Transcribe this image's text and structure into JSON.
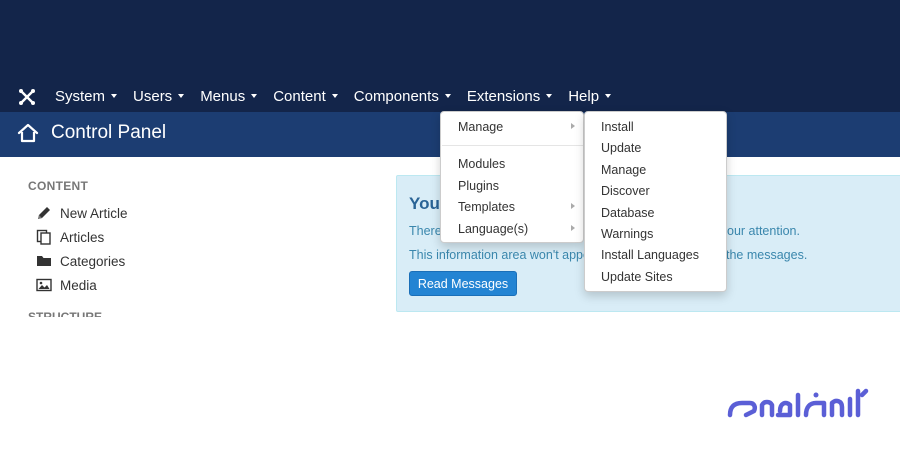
{
  "nav": {
    "items": [
      {
        "label": "System"
      },
      {
        "label": "Users"
      },
      {
        "label": "Menus"
      },
      {
        "label": "Content"
      },
      {
        "label": "Components"
      },
      {
        "label": "Extensions"
      },
      {
        "label": "Help"
      }
    ],
    "active": "Extensions"
  },
  "header": {
    "title": "Control Panel",
    "icon": "home-icon"
  },
  "sidebar": {
    "heading": "CONTENT",
    "items": [
      {
        "label": "New Article",
        "icon": "pencil-icon"
      },
      {
        "label": "Articles",
        "icon": "copy-icon"
      },
      {
        "label": "Categories",
        "icon": "folder-icon"
      },
      {
        "label": "Media",
        "icon": "image-icon"
      }
    ],
    "next_heading": "STRUCTURE"
  },
  "alert": {
    "heading": "You",
    "line1_start": "There",
    "line1_end": "our attention.",
    "line2_start": "This information area won't appea",
    "line2_end": "the messages.",
    "button": "Read Messages"
  },
  "extensions_menu": {
    "items": [
      {
        "label": "Manage",
        "has_submenu": true
      },
      {
        "label": "Modules",
        "has_submenu": false
      },
      {
        "label": "Plugins",
        "has_submenu": false
      },
      {
        "label": "Templates",
        "has_submenu": true
      },
      {
        "label": "Language(s)",
        "has_submenu": true
      }
    ]
  },
  "manage_submenu": {
    "items": [
      {
        "label": "Install"
      },
      {
        "label": "Update"
      },
      {
        "label": "Manage"
      },
      {
        "label": "Discover"
      },
      {
        "label": "Database"
      },
      {
        "label": "Warnings"
      },
      {
        "label": "Install Languages"
      },
      {
        "label": "Update Sites"
      }
    ]
  },
  "watermark": {
    "text": "ایران سرور",
    "color": "#5b5fd6"
  },
  "colors": {
    "topbar": "#13254a",
    "subheader": "#1c3d72",
    "alert_bg": "#d9edf7",
    "button": "#2384d3"
  }
}
